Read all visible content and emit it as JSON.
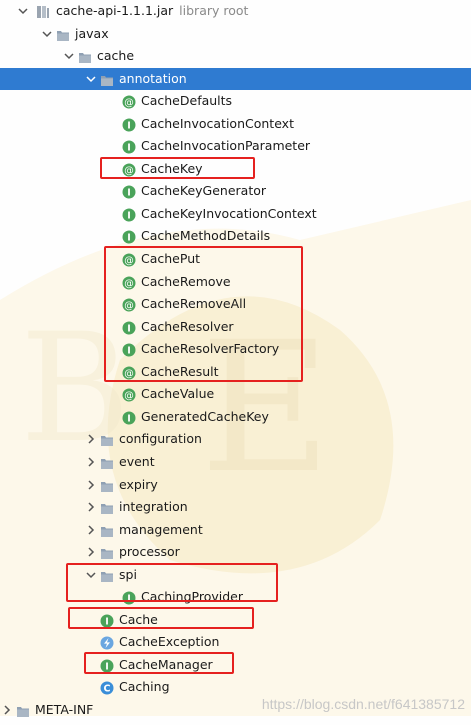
{
  "root": {
    "label": "cache-api-1.1.1.jar",
    "suffix": "library root"
  },
  "tree": [
    {
      "depth": 1,
      "expanded": true,
      "type": "folder",
      "label": "javax"
    },
    {
      "depth": 2,
      "expanded": true,
      "type": "folder",
      "label": "cache"
    },
    {
      "depth": 3,
      "expanded": true,
      "type": "folder",
      "label": "annotation",
      "selected": true
    },
    {
      "depth": 4,
      "type": "annotation",
      "label": "CacheDefaults"
    },
    {
      "depth": 4,
      "type": "interface",
      "label": "CacheInvocationContext"
    },
    {
      "depth": 4,
      "type": "interface",
      "label": "CacheInvocationParameter"
    },
    {
      "depth": 4,
      "type": "annotation",
      "label": "CacheKey"
    },
    {
      "depth": 4,
      "type": "interface",
      "label": "CacheKeyGenerator"
    },
    {
      "depth": 4,
      "type": "interface",
      "label": "CacheKeyInvocationContext"
    },
    {
      "depth": 4,
      "type": "interface",
      "label": "CacheMethodDetails"
    },
    {
      "depth": 4,
      "type": "annotation",
      "label": "CachePut"
    },
    {
      "depth": 4,
      "type": "annotation",
      "label": "CacheRemove"
    },
    {
      "depth": 4,
      "type": "annotation",
      "label": "CacheRemoveAll"
    },
    {
      "depth": 4,
      "type": "interface",
      "label": "CacheResolver"
    },
    {
      "depth": 4,
      "type": "interface",
      "label": "CacheResolverFactory"
    },
    {
      "depth": 4,
      "type": "annotation",
      "label": "CacheResult"
    },
    {
      "depth": 4,
      "type": "annotation",
      "label": "CacheValue"
    },
    {
      "depth": 4,
      "type": "interface",
      "label": "GeneratedCacheKey"
    },
    {
      "depth": 3,
      "expanded": false,
      "type": "folder",
      "label": "configuration"
    },
    {
      "depth": 3,
      "expanded": false,
      "type": "folder",
      "label": "event"
    },
    {
      "depth": 3,
      "expanded": false,
      "type": "folder",
      "label": "expiry"
    },
    {
      "depth": 3,
      "expanded": false,
      "type": "folder",
      "label": "integration"
    },
    {
      "depth": 3,
      "expanded": false,
      "type": "folder",
      "label": "management"
    },
    {
      "depth": 3,
      "expanded": false,
      "type": "folder",
      "label": "processor"
    },
    {
      "depth": 3,
      "expanded": true,
      "type": "folder",
      "label": "spi"
    },
    {
      "depth": 4,
      "type": "interface",
      "label": "CachingProvider"
    },
    {
      "depth": 3,
      "type": "interface",
      "label": "Cache"
    },
    {
      "depth": 3,
      "type": "exception",
      "label": "CacheException"
    },
    {
      "depth": 3,
      "type": "interface",
      "label": "CacheManager"
    },
    {
      "depth": 3,
      "type": "class",
      "label": "Caching"
    },
    {
      "depth": 0,
      "expanded": false,
      "type": "folder",
      "label": "META-INF"
    }
  ],
  "watermark": "https://blog.csdn.net/f641385712",
  "colors": {
    "selection": "#2f7bd1",
    "highlight": "#e5211f",
    "interface": "#3e9a4a",
    "class": "#3a8ed8",
    "folder": "#8a96a5"
  }
}
